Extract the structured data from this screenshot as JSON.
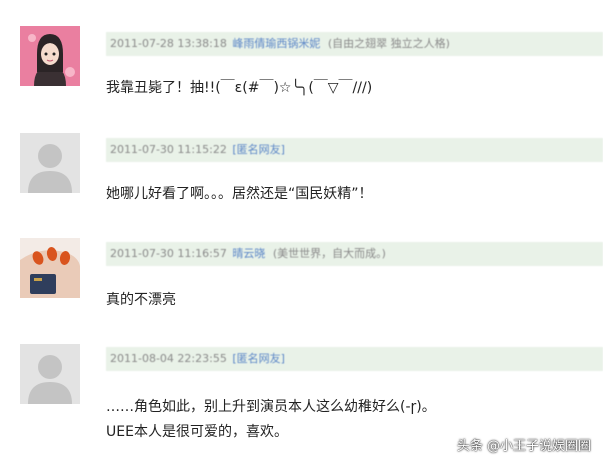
{
  "comments": [
    {
      "time": "2011-07-28 13:38:18",
      "user": "峰雨倩瑜西锅米妮",
      "note": "(自由之翅翠 独立之人格)",
      "lines": [
        "我靠丑毙了！抽!!(￣ε(#￣)☆╰╮(￣▽￣///)"
      ],
      "avatar": "avatar-girl-illustration"
    },
    {
      "time": "2011-07-30 11:15:22",
      "user": "[匿名网友]",
      "note": "",
      "lines": [
        "她哪儿好看了啊。。。居然还是“国民妖精”！"
      ],
      "avatar": "avatar-default-silhouette"
    },
    {
      "time": "2011-07-30 11:16:57",
      "user": "晴云晓",
      "note": "(美世世界，自大而成。)",
      "lines": [
        "真的不漂亮"
      ],
      "avatar": "avatar-painted-nails"
    },
    {
      "time": "2011-08-04 22:23:55",
      "user": "[匿名网友]",
      "note": "",
      "lines": [
        "……角色如此，别上升到演员本人这么幼稚好么(-ɼ)。",
        "UEE本人是很可爱的，喜欢。"
      ],
      "avatar": "avatar-default-silhouette"
    }
  ],
  "watermark": "头条 @小王子说娱圈圈",
  "colors": {
    "meta_bg": "#e9f2e8",
    "username": "#5b86c7",
    "meta_text": "#8a8a8a"
  }
}
